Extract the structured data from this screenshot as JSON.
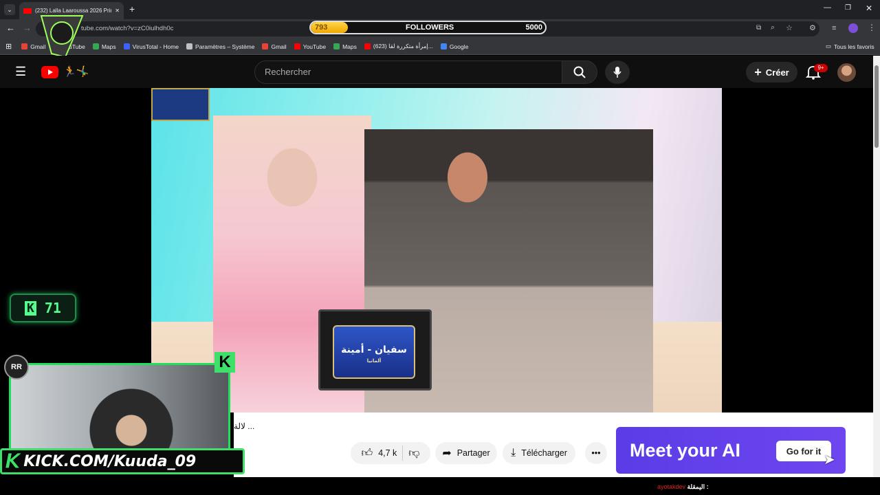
{
  "browser": {
    "tab_title": "(232) Lalla Laaroussa 2026 Prim",
    "url": "tube.com/watch?v=zC0iulhdh0c",
    "bookmarks": [
      {
        "label": "Gmail",
        "icon": "gmail-icon",
        "color": "#ea4335"
      },
      {
        "label": "YouTube",
        "icon": "youtube-icon",
        "color": "#ff0000"
      },
      {
        "label": "Maps",
        "icon": "maps-icon",
        "color": "#34a853"
      },
      {
        "label": "VirusTotal - Home",
        "icon": "virustotal-icon",
        "color": "#3b61ff"
      },
      {
        "label": "Paramètres – Système",
        "icon": "gear-icon",
        "color": "#bdc1c6"
      },
      {
        "label": "Gmail",
        "icon": "gmail-icon",
        "color": "#ea4335"
      },
      {
        "label": "YouTube",
        "icon": "youtube-icon",
        "color": "#ff0000"
      },
      {
        "label": "Maps",
        "icon": "maps-icon",
        "color": "#34a853"
      },
      {
        "label": "(623) إمرأة متكررة لقا...",
        "icon": "youtube-icon",
        "color": "#ff0000"
      },
      {
        "label": "Google",
        "icon": "google-icon",
        "color": "#4285f4"
      }
    ],
    "all_bookmarks": "Tous les favoris"
  },
  "followers": {
    "current": "793",
    "label": "FOLLOWERS",
    "goal": "5000",
    "progress": 0.159
  },
  "youtube": {
    "search_placeholder": "Rechercher",
    "create_label": "Créer",
    "notifications": "9+",
    "video_title": "لالة ...",
    "likes": "4,7 k",
    "share_label": "Partager",
    "download_label": "Télécharger",
    "card_names": "سفيان - أمينة",
    "card_sub": "ألمانيا"
  },
  "ad": {
    "headline": "Meet your AI",
    "cta": "Go for it",
    "color": "#5b3ce6"
  },
  "stream": {
    "kick_count": "71",
    "kick_url": "KICK.COM/Kuuda_09",
    "credit_label": "ayotakdev",
    "credit_prefix": "اليمقلة :"
  },
  "colors": {
    "kick_green": "#3ee06a",
    "yt_red": "#ff0000"
  }
}
